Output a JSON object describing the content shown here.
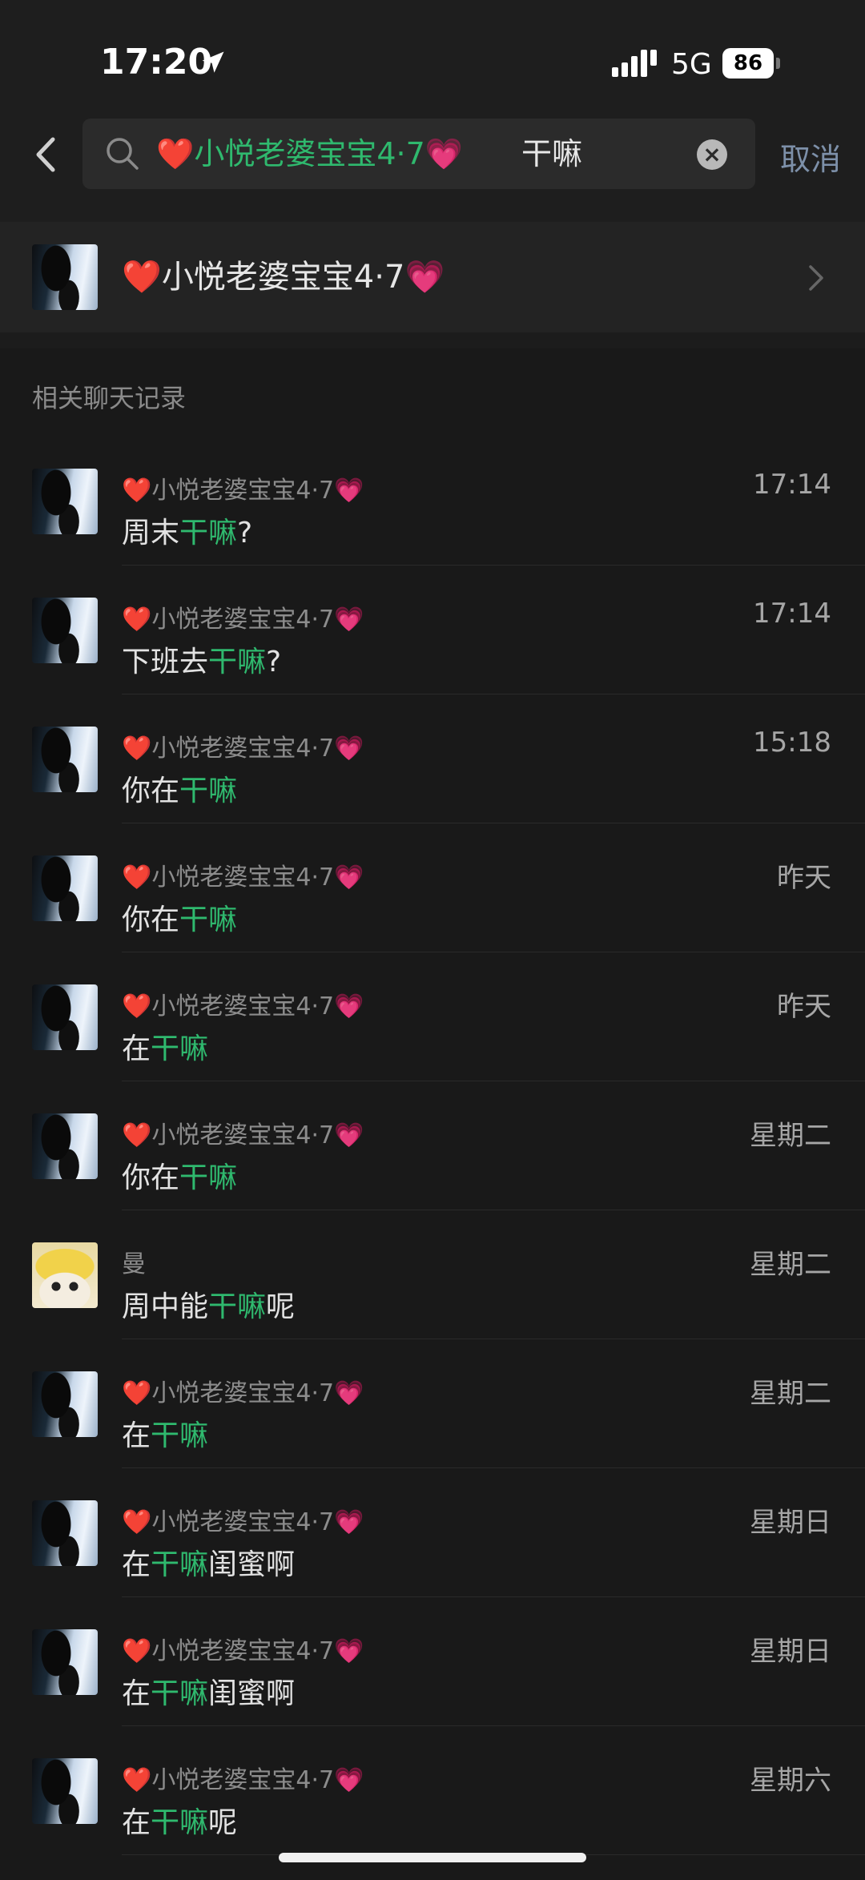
{
  "status_bar": {
    "time": "17:20",
    "network": "5G",
    "battery": "86"
  },
  "search": {
    "contact_chip": {
      "prefix_emoji": "❤️",
      "name": "小悦老婆宝宝4·7",
      "suffix_emoji": "💗"
    },
    "query": "干嘛",
    "cancel_label": "取消"
  },
  "contact": {
    "prefix_emoji": "❤️",
    "name": "小悦老婆宝宝4·7",
    "suffix_emoji": "💗"
  },
  "section_title": "相关聊天记录",
  "results": [
    {
      "sender": "小悦老婆宝宝4·7",
      "time": "17:14",
      "before": "周末",
      "match": "干嘛",
      "after": "?"
    },
    {
      "sender": "小悦老婆宝宝4·7",
      "time": "17:14",
      "before": "下班去",
      "match": "干嘛",
      "after": "?"
    },
    {
      "sender": "小悦老婆宝宝4·7",
      "time": "15:18",
      "before": "你在",
      "match": "干嘛",
      "after": ""
    },
    {
      "sender": "小悦老婆宝宝4·7",
      "time": "昨天",
      "before": "你在",
      "match": "干嘛",
      "after": ""
    },
    {
      "sender": "小悦老婆宝宝4·7",
      "time": "昨天",
      "before": "在",
      "match": "干嘛",
      "after": ""
    },
    {
      "sender": "小悦老婆宝宝4·7",
      "time": "星期二",
      "before": "你在",
      "match": "干嘛",
      "after": ""
    },
    {
      "sender": "曼",
      "time": "星期二",
      "before": "周中能",
      "match": "干嘛",
      "after": "呢"
    },
    {
      "sender": "小悦老婆宝宝4·7",
      "time": "星期二",
      "before": "在",
      "match": "干嘛",
      "after": ""
    },
    {
      "sender": "小悦老婆宝宝4·7",
      "time": "星期日",
      "before": "在",
      "match": "干嘛",
      "after": "闺蜜啊"
    },
    {
      "sender": "小悦老婆宝宝4·7",
      "time": "星期日",
      "before": "在",
      "match": "干嘛",
      "after": "闺蜜啊"
    },
    {
      "sender": "小悦老婆宝宝4·7",
      "time": "星期六",
      "before": "在",
      "match": "干嘛",
      "after": "呢"
    }
  ],
  "colors": {
    "highlight": "#2fb96e",
    "background": "#191919",
    "cancel": "#7d90a9"
  }
}
